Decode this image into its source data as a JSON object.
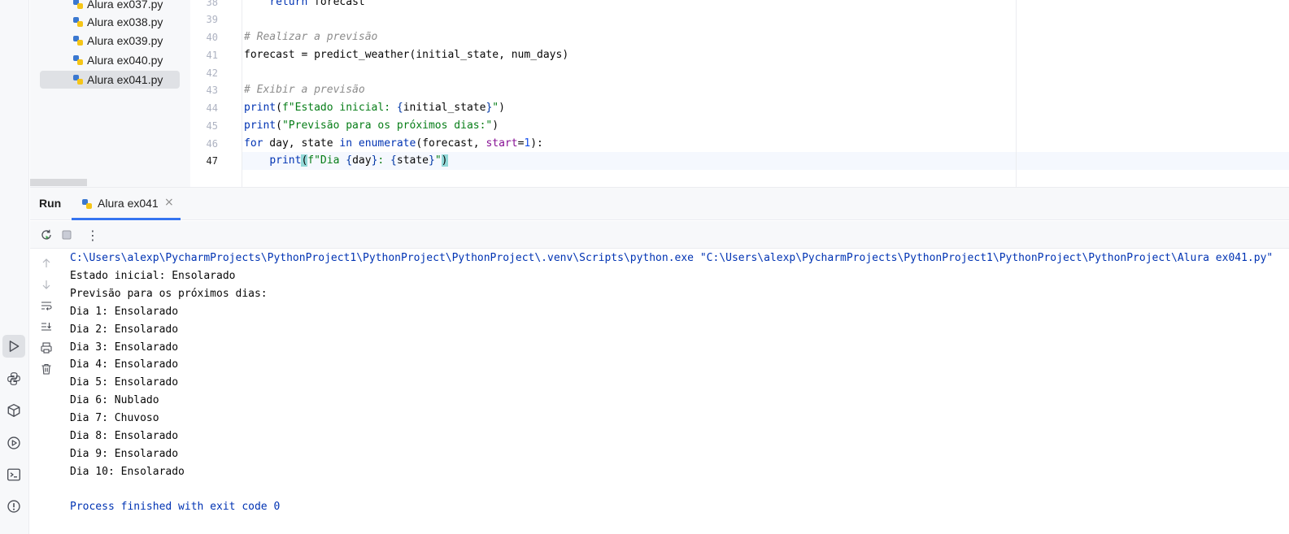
{
  "project_tree": {
    "items": [
      {
        "label": "Alura ex037.py"
      },
      {
        "label": "Alura ex038.py"
      },
      {
        "label": "Alura ex039.py"
      },
      {
        "label": "Alura ex040.py"
      },
      {
        "label": "Alura ex041.py",
        "selected": true
      }
    ]
  },
  "editor": {
    "line_numbers": [
      "38",
      "39",
      "40",
      "41",
      "42",
      "43",
      "44",
      "45",
      "46",
      "47"
    ],
    "current_line": "47",
    "lines": {
      "l38": {
        "kw": "return",
        "rest": " forecast"
      },
      "l40": {
        "comment": "# Realizar a previsão"
      },
      "l41": {
        "a": "forecast = ",
        "fn": "predict_weather",
        "b": "(initial_state, num_days)"
      },
      "l43": {
        "comment": "# Exibir a previsão"
      },
      "l44": {
        "fn": "print",
        "a": "(",
        "s1": "f\"Estado inicial: ",
        "br1": "{",
        "v": "initial_state",
        "br2": "}",
        "s2": "\"",
        "b": ")"
      },
      "l45": {
        "fn": "print",
        "a": "(",
        "s": "\"Previsão para os próximos dias:\"",
        "b": ")"
      },
      "l46": {
        "kw1": "for",
        "a": " day, state ",
        "kw2": "in",
        "b": " ",
        "fn": "enumerate",
        "c": "(forecast, ",
        "p": "start",
        "d": "=",
        "n": "1",
        "e": "):"
      },
      "l47": {
        "indent": "    ",
        "fn": "print",
        "pa": "(",
        "s1": "f\"Dia ",
        "br1": "{",
        "v1": "day",
        "br2": "}",
        "s2": ": ",
        "br3": "{",
        "v2": "state",
        "br4": "}",
        "s3": "\"",
        "pb": ")"
      }
    }
  },
  "run_panel": {
    "title": "Run",
    "tab": {
      "label": "Alura ex041",
      "close": "×"
    },
    "toolbar": {
      "more": "⋮"
    }
  },
  "console": {
    "command": "C:\\Users\\alexp\\PycharmProjects\\PythonProject1\\PythonProject\\PythonProject\\.venv\\Scripts\\python.exe \"C:\\Users\\alexp\\PycharmProjects\\PythonProject1\\PythonProject\\PythonProject\\Alura ex041.py\"",
    "output": [
      "Estado inicial: Ensolarado",
      "Previsão para os próximos dias:",
      "Dia 1: Ensolarado",
      "Dia 2: Ensolarado",
      "Dia 3: Ensolarado",
      "Dia 4: Ensolarado",
      "Dia 5: Ensolarado",
      "Dia 6: Nublado",
      "Dia 7: Chuvoso",
      "Dia 8: Ensolarado",
      "Dia 9: Ensolarado",
      "Dia 10: Ensolarado"
    ],
    "exit": "Process finished with exit code 0"
  },
  "colors": {
    "accent": "#3574f0",
    "python_blue": "#3b78d0",
    "python_yellow": "#f5c518"
  }
}
